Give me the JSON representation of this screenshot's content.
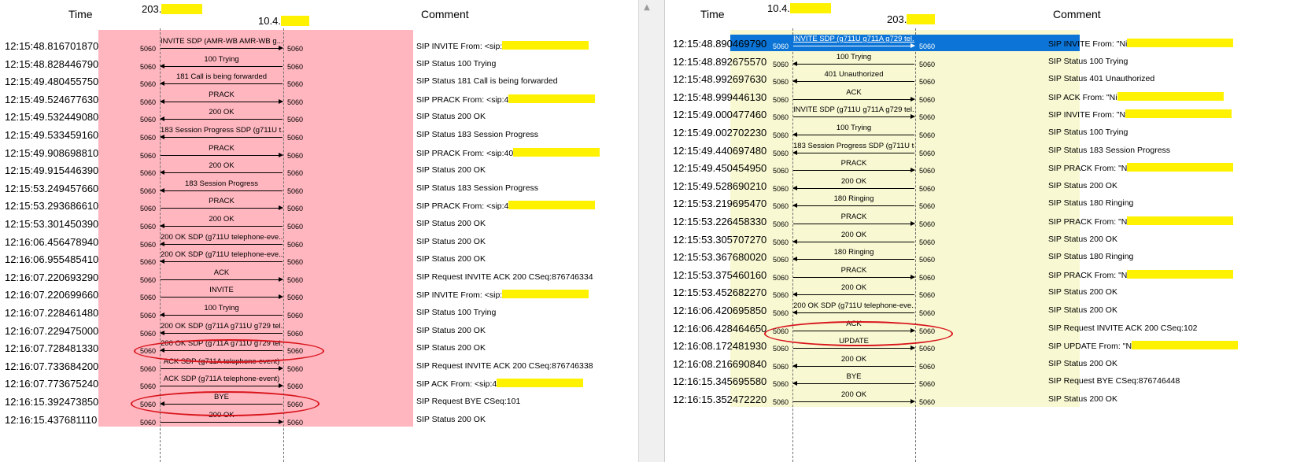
{
  "left": {
    "header": {
      "time": "Time",
      "comment": "Comment",
      "ip_a": "203.",
      "ip_b": "10.4."
    },
    "bg_color": "#ffb6bf",
    "rows": [
      {
        "time": "12:15:48.816701870",
        "port_a": "5060",
        "port_b": "5060",
        "msg": "INVITE SDP (AMR-WB AMR-WB g...",
        "dir": "r",
        "comment": "SIP INVITE From: <sip:",
        "redacted": true
      },
      {
        "time": "12:15:48.828446790",
        "port_a": "5060",
        "port_b": "5060",
        "msg": "100 Trying",
        "dir": "l",
        "comment": "SIP Status 100 Trying",
        "redacted": false
      },
      {
        "time": "12:15:49.480455750",
        "port_a": "5060",
        "port_b": "5060",
        "msg": "181 Call is being forwarded",
        "dir": "l",
        "comment": "SIP Status 181 Call is being forwarded",
        "redacted": false
      },
      {
        "time": "12:15:49.524677630",
        "port_a": "5060",
        "port_b": "5060",
        "msg": "PRACK",
        "dir": "b",
        "comment": "SIP PRACK From: <sip:4",
        "redacted": true
      },
      {
        "time": "12:15:49.532449080",
        "port_a": "5060",
        "port_b": "5060",
        "msg": "200 OK",
        "dir": "l",
        "comment": "SIP Status 200 OK",
        "redacted": false
      },
      {
        "time": "12:15:49.533459160",
        "port_a": "5060",
        "port_b": "5060",
        "msg": "183 Session Progress SDP (g711U t...",
        "dir": "l",
        "comment": "SIP Status 183 Session Progress",
        "redacted": false
      },
      {
        "time": "12:15:49.908698810",
        "port_a": "5060",
        "port_b": "5060",
        "msg": "PRACK",
        "dir": "r",
        "comment": "SIP PRACK From: <sip:40",
        "redacted": true
      },
      {
        "time": "12:15:49.915446390",
        "port_a": "5060",
        "port_b": "5060",
        "msg": "200 OK",
        "dir": "l",
        "comment": "SIP Status 200 OK",
        "redacted": false
      },
      {
        "time": "12:15:53.249457660",
        "port_a": "5060",
        "port_b": "5060",
        "msg": "183 Session Progress",
        "dir": "l",
        "comment": "SIP Status 183 Session Progress",
        "redacted": false
      },
      {
        "time": "12:15:53.293686610",
        "port_a": "5060",
        "port_b": "5060",
        "msg": "PRACK",
        "dir": "r",
        "comment": "SIP PRACK From: <sip:4",
        "redacted": true
      },
      {
        "time": "12:15:53.301450390",
        "port_a": "5060",
        "port_b": "5060",
        "msg": "200 OK",
        "dir": "l",
        "comment": "SIP Status 200 OK",
        "redacted": false
      },
      {
        "time": "12:16:06.456478940",
        "port_a": "5060",
        "port_b": "5060",
        "msg": "200 OK SDP (g711U telephone-eve...",
        "dir": "l",
        "comment": "SIP Status 200 OK",
        "redacted": false
      },
      {
        "time": "12:16:06.955485410",
        "port_a": "5060",
        "port_b": "5060",
        "msg": "200 OK SDP (g711U telephone-eve...",
        "dir": "l",
        "comment": "SIP Status 200 OK",
        "redacted": false
      },
      {
        "time": "12:16:07.220693290",
        "port_a": "5060",
        "port_b": "5060",
        "msg": "ACK",
        "dir": "r",
        "comment": "SIP Request INVITE ACK 200 CSeq:876746334",
        "redacted": false
      },
      {
        "time": "12:16:07.220699660",
        "port_a": "5060",
        "port_b": "5060",
        "msg": "INVITE",
        "dir": "r",
        "comment": "SIP INVITE From: <sip:",
        "redacted": true
      },
      {
        "time": "12:16:07.228461480",
        "port_a": "5060",
        "port_b": "5060",
        "msg": "100 Trying",
        "dir": "l",
        "comment": "SIP Status 100 Trying",
        "redacted": false
      },
      {
        "time": "12:16:07.229475000",
        "port_a": "5060",
        "port_b": "5060",
        "msg": "200 OK SDP (g711A g711U g729 tel...",
        "dir": "l",
        "comment": "SIP Status 200 OK",
        "redacted": false
      },
      {
        "time": "12:16:07.728481330",
        "port_a": "5060",
        "port_b": "5060",
        "msg": "200 OK SDP (g711A g711U g729 tel...",
        "dir": "l",
        "comment": "SIP Status 200 OK",
        "redacted": false
      },
      {
        "time": "12:16:07.733684200",
        "port_a": "5060",
        "port_b": "5060",
        "msg": "ACK SDP (g711A telephone-event)",
        "dir": "r",
        "comment": "SIP Request INVITE ACK 200 CSeq:876746338",
        "redacted": false
      },
      {
        "time": "12:16:07.773675240",
        "port_a": "5060",
        "port_b": "5060",
        "msg": "ACK SDP (g711A telephone-event)",
        "dir": "r",
        "comment": "SIP ACK From: <sip:4",
        "redacted": true
      },
      {
        "time": "12:16:15.392473850",
        "port_a": "5060",
        "port_b": "5060",
        "msg": "BYE",
        "dir": "l",
        "comment": "SIP Request BYE CSeq:101",
        "redacted": false
      },
      {
        "time": "12:16:15.437681110",
        "port_a": "5060",
        "port_b": "5060",
        "msg": "200 OK",
        "dir": "r",
        "comment": "SIP Status 200 OK",
        "redacted": false
      }
    ]
  },
  "right": {
    "header": {
      "time": "Time",
      "comment": "Comment",
      "ip_a": "10.4.",
      "ip_b": "203."
    },
    "bg_color": "#f8f8d2",
    "selected_color": "#0b74d6",
    "rows": [
      {
        "time": "12:15:48.890469790",
        "port_a": "5060",
        "port_b": "5060",
        "msg": "INVITE SDP (g711U g711A g729 tel...",
        "dir": "r",
        "comment": "SIP INVITE From: \"Ni",
        "redacted": true,
        "selected": true
      },
      {
        "time": "12:15:48.892675570",
        "port_a": "5060",
        "port_b": "5060",
        "msg": "100 Trying",
        "dir": "l",
        "comment": "SIP Status 100 Trying",
        "redacted": false
      },
      {
        "time": "12:15:48.992697630",
        "port_a": "5060",
        "port_b": "5060",
        "msg": "401 Unauthorized",
        "dir": "l",
        "comment": "SIP Status 401 Unauthorized",
        "redacted": false
      },
      {
        "time": "12:15:48.999446130",
        "port_a": "5060",
        "port_b": "5060",
        "msg": "ACK",
        "dir": "r",
        "comment": "SIP ACK From: \"Ni",
        "redacted": true
      },
      {
        "time": "12:15:49.000477460",
        "port_a": "5060",
        "port_b": "5060",
        "msg": "INVITE SDP (g711U g711A g729 tel...",
        "dir": "r",
        "comment": "SIP INVITE From: \"N",
        "redacted": true
      },
      {
        "time": "12:15:49.002702230",
        "port_a": "5060",
        "port_b": "5060",
        "msg": "100 Trying",
        "dir": "l",
        "comment": "SIP Status 100 Trying",
        "redacted": false
      },
      {
        "time": "12:15:49.440697480",
        "port_a": "5060",
        "port_b": "5060",
        "msg": "183 Session Progress SDP (g711U tel...",
        "dir": "l",
        "comment": "SIP Status 183 Session Progress",
        "redacted": false
      },
      {
        "time": "12:15:49.450454950",
        "port_a": "5060",
        "port_b": "5060",
        "msg": "PRACK",
        "dir": "r",
        "comment": "SIP PRACK From: \"N",
        "redacted": true
      },
      {
        "time": "12:15:49.528690210",
        "port_a": "5060",
        "port_b": "5060",
        "msg": "200 OK",
        "dir": "l",
        "comment": "SIP Status 200 OK",
        "redacted": false
      },
      {
        "time": "12:15:53.219695470",
        "port_a": "5060",
        "port_b": "5060",
        "msg": "180 Ringing",
        "dir": "l",
        "comment": "SIP Status 180 Ringing",
        "redacted": false
      },
      {
        "time": "12:15:53.226458330",
        "port_a": "5060",
        "port_b": "5060",
        "msg": "PRACK",
        "dir": "r",
        "comment": "SIP PRACK From: \"N",
        "redacted": true
      },
      {
        "time": "12:15:53.305707270",
        "port_a": "5060",
        "port_b": "5060",
        "msg": "200 OK",
        "dir": "l",
        "comment": "SIP Status 200 OK",
        "redacted": false
      },
      {
        "time": "12:15:53.367680020",
        "port_a": "5060",
        "port_b": "5060",
        "msg": "180 Ringing",
        "dir": "l",
        "comment": "SIP Status 180 Ringing",
        "redacted": false
      },
      {
        "time": "12:15:53.375460160",
        "port_a": "5060",
        "port_b": "5060",
        "msg": "PRACK",
        "dir": "r",
        "comment": "SIP PRACK From: \"N",
        "redacted": true
      },
      {
        "time": "12:15:53.452682270",
        "port_a": "5060",
        "port_b": "5060",
        "msg": "200 OK",
        "dir": "l",
        "comment": "SIP Status 200 OK",
        "redacted": false
      },
      {
        "time": "12:16:06.420695850",
        "port_a": "5060",
        "port_b": "5060",
        "msg": "200 OK SDP (g711U telephone-eve...",
        "dir": "l",
        "comment": "SIP Status 200 OK",
        "redacted": false
      },
      {
        "time": "12:16:06.428464650",
        "port_a": "5060",
        "port_b": "5060",
        "msg": "ACK",
        "dir": "r",
        "comment": "SIP Request INVITE ACK 200 CSeq:102",
        "redacted": false
      },
      {
        "time": "12:16:08.172481930",
        "port_a": "5060",
        "port_b": "5060",
        "msg": "UPDATE",
        "dir": "r",
        "comment": "SIP UPDATE From: \"N",
        "redacted": true
      },
      {
        "time": "12:16:08.216690840",
        "port_a": "5060",
        "port_b": "5060",
        "msg": "200 OK",
        "dir": "l",
        "comment": "SIP Status 200 OK",
        "redacted": false
      },
      {
        "time": "12:16:15.345695580",
        "port_a": "5060",
        "port_b": "5060",
        "msg": "BYE",
        "dir": "l",
        "comment": "SIP Request BYE CSeq:876746448",
        "redacted": false
      },
      {
        "time": "12:16:15.352472220",
        "port_a": "5060",
        "port_b": "5060",
        "msg": "200 OK",
        "dir": "r",
        "comment": "SIP Status 200 OK",
        "redacted": false
      }
    ]
  },
  "colors": {
    "redaction": "#fff200",
    "annotation": "#d8141c"
  }
}
